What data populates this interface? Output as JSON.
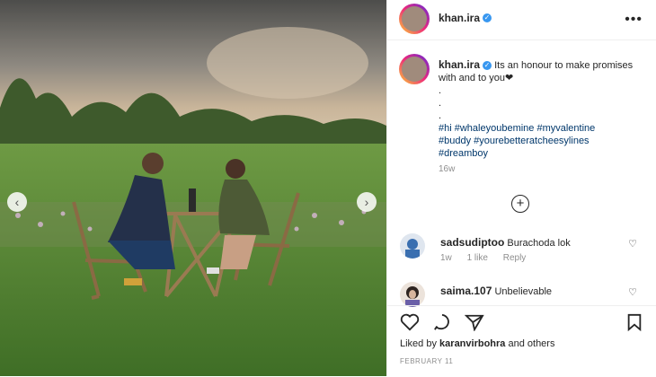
{
  "post": {
    "username": "khan.ira",
    "caption_text": "Its an honour to make promises with and to you❤",
    "caption_dots": [
      ".",
      ".",
      "."
    ],
    "hashtags_line1": "#hi #whaleyoubemine #myvalentine",
    "hashtags_line2": "#buddy #yourebetteratcheesylines",
    "hashtags_line3": "#dreamboy",
    "time_ago": "16w",
    "more_glyph": "•••",
    "load_more_glyph": "+"
  },
  "comments": [
    {
      "username": "sadsudiptoo",
      "text": "Burachoda lok",
      "time": "1w",
      "likes": "1 like",
      "reply": "Reply"
    },
    {
      "username": "saima.107",
      "text": "Unbelievable"
    }
  ],
  "footer": {
    "liked_by_prefix": "Liked by",
    "liked_by_user": "karanvirbohra",
    "liked_by_suffix": "and others",
    "date": "FEBRUARY 11"
  },
  "icons": {
    "verified": "verified-badge-icon",
    "like": "heart-icon",
    "comment": "comment-icon",
    "share": "paper-plane-icon",
    "save": "bookmark-icon"
  },
  "colors": {
    "verified": "#3897f0",
    "hashtag": "#00376b",
    "muted": "#8e8e8e"
  }
}
